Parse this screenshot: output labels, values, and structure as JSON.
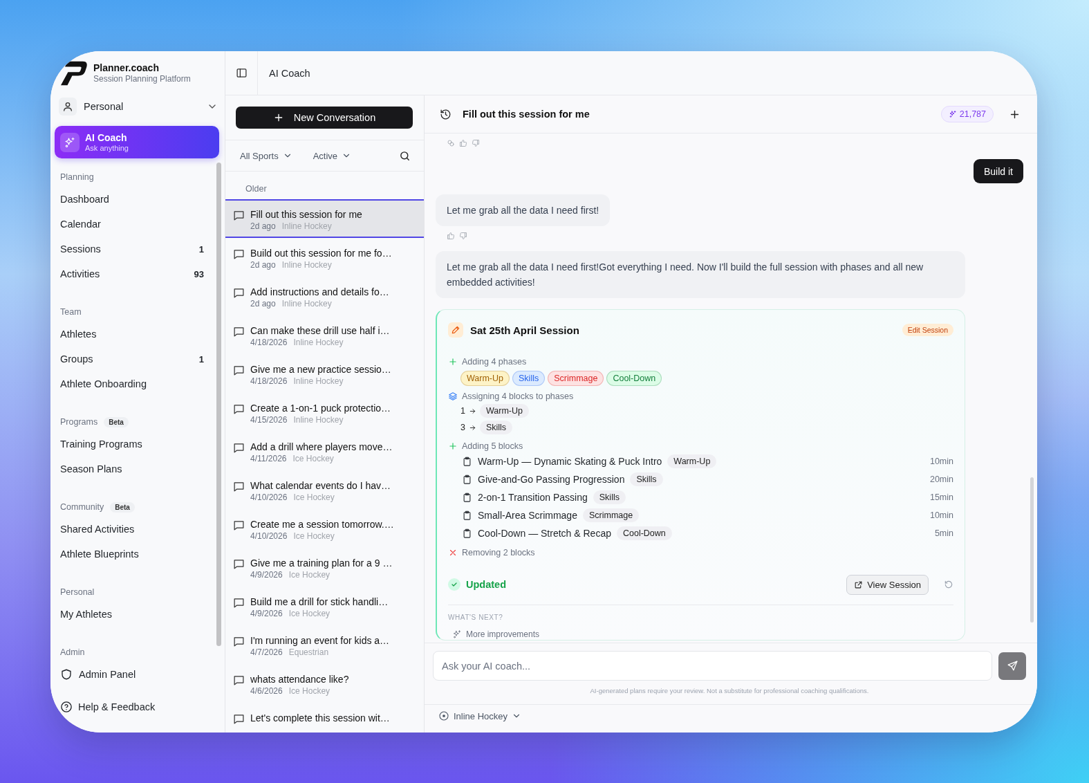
{
  "app": {
    "name": "Planner.coach",
    "tagline": "Session Planning Platform"
  },
  "workspace": {
    "label": "Personal"
  },
  "ai_coach": {
    "title": "AI Coach",
    "subtitle": "Ask anything",
    "selected": true
  },
  "sidebar": {
    "sections": [
      {
        "title": "Planning",
        "items": [
          {
            "label": "Dashboard"
          },
          {
            "label": "Calendar"
          },
          {
            "label": "Sessions",
            "count": "1"
          },
          {
            "label": "Activities",
            "count": "93"
          }
        ]
      },
      {
        "title": "Team",
        "items": [
          {
            "label": "Athletes"
          },
          {
            "label": "Groups",
            "count": "1"
          },
          {
            "label": "Athlete Onboarding"
          }
        ]
      },
      {
        "title": "Programs",
        "badge": "Beta",
        "items": [
          {
            "label": "Training Programs"
          },
          {
            "label": "Season Plans"
          }
        ]
      },
      {
        "title": "Community",
        "badge": "Beta",
        "items": [
          {
            "label": "Shared Activities"
          },
          {
            "label": "Athlete Blueprints"
          }
        ]
      },
      {
        "title": "Personal",
        "items": [
          {
            "label": "My Athletes"
          }
        ]
      },
      {
        "title": "Admin",
        "items": [
          {
            "label": "Admin Panel",
            "kind": "shield"
          }
        ]
      }
    ]
  },
  "footer": {
    "label": "Help & Feedback"
  },
  "topbar": {
    "title": "AI Coach"
  },
  "conversations_panel": {
    "new_button": "New Conversation",
    "filters": [
      {
        "label": "All Sports"
      },
      {
        "label": "Active"
      }
    ],
    "group": "Older",
    "items": [
      {
        "title": "Fill out this session for me",
        "date": "2d ago",
        "sport": "Inline Hockey",
        "selected": true
      },
      {
        "title": "Build out this session for me fo…",
        "date": "2d ago",
        "sport": "Inline Hockey",
        "selected": false
      },
      {
        "title": "Add instructions and details fo…",
        "date": "2d ago",
        "sport": "Inline Hockey",
        "selected": false
      },
      {
        "title": "Can make these drill use half i…",
        "date": "4/18/2026",
        "sport": "Inline Hockey",
        "selected": false
      },
      {
        "title": "Give me a new practice sessio…",
        "date": "4/18/2026",
        "sport": "Inline Hockey",
        "selected": false
      },
      {
        "title": "Create a 1-on-1 puck protectio…",
        "date": "4/15/2026",
        "sport": "Inline Hockey",
        "selected": false
      },
      {
        "title": "Add a drill where players move…",
        "date": "4/11/2026",
        "sport": "Ice Hockey",
        "selected": false
      },
      {
        "title": "What calendar events do I hav…",
        "date": "4/10/2026",
        "sport": "Ice Hockey",
        "selected": false
      },
      {
        "title": "Create me a session tomorrow.…",
        "date": "4/10/2026",
        "sport": "Ice Hockey",
        "selected": false
      },
      {
        "title": "Give me a training plan for a 9 …",
        "date": "4/9/2026",
        "sport": "Ice Hockey",
        "selected": false
      },
      {
        "title": "Build me a drill for stick handli…",
        "date": "4/9/2026",
        "sport": "Ice Hockey",
        "selected": false
      },
      {
        "title": "I'm running an event for kids a…",
        "date": "4/7/2026",
        "sport": "Equestrian",
        "selected": false
      },
      {
        "title": "whats attendance like?",
        "date": "4/6/2026",
        "sport": "Ice Hockey",
        "selected": false
      },
      {
        "title": "Let's complete this session wit…",
        "selected": false
      }
    ]
  },
  "chat": {
    "title": "Fill out this session for me",
    "credits": "21,787",
    "messages": [
      {
        "kind": "feedback",
        "copy": true
      },
      {
        "kind": "user",
        "text": "Build it"
      },
      {
        "kind": "assistant",
        "text": "Let me grab all the data I need first!"
      },
      {
        "kind": "feedback",
        "copy": false
      },
      {
        "kind": "assistant",
        "text": "Let me grab all the data I need first!Got everything I need. Now I'll build the full session with phases and all new embedded activities!"
      }
    ],
    "session_card": {
      "title": "Sat 25th April Session",
      "action": "Edit Session",
      "steps": [
        {
          "kind": "add",
          "text": "Adding 4 phases",
          "phases": [
            {
              "label": "Warm-Up",
              "color": "#a16207"
            },
            {
              "label": "Skills",
              "color": "#2563eb"
            },
            {
              "label": "Scrimmage",
              "color": "#dc2626"
            },
            {
              "label": "Cool-Down",
              "color": "#15803d"
            }
          ]
        },
        {
          "kind": "assign",
          "text": "Assigning 4 blocks to phases",
          "assignments": [
            {
              "number": "1",
              "phase": "Warm-Up"
            },
            {
              "number": "3",
              "phase": "Skills"
            }
          ]
        },
        {
          "kind": "add",
          "text": "Adding 5 blocks",
          "blocks": [
            {
              "name": "Warm-Up — Dynamic Skating & Puck Intro",
              "phase": "Warm-Up",
              "duration": "10min"
            },
            {
              "name": "Give-and-Go Passing Progression",
              "phase": "Skills",
              "duration": "20min"
            },
            {
              "name": "2-on-1 Transition Passing",
              "phase": "Skills",
              "duration": "15min"
            },
            {
              "name": "Small-Area Scrimmage",
              "phase": "Scrimmage",
              "duration": "10min"
            },
            {
              "name": "Cool-Down — Stretch & Recap",
              "phase": "Cool-Down",
              "duration": "5min"
            }
          ]
        },
        {
          "kind": "remove",
          "text": "Removing 2 blocks"
        }
      ],
      "status": "Updated",
      "view_button": "View Session",
      "next_heading": "WHAT'S NEXT?",
      "suggestions": [
        "More improvements"
      ]
    },
    "input": {
      "placeholder": "Ask your AI coach..."
    },
    "disclaimer": "AI-generated plans require your review. Not a substitute for professional coaching qualifications.",
    "sport": "Inline Hockey"
  }
}
